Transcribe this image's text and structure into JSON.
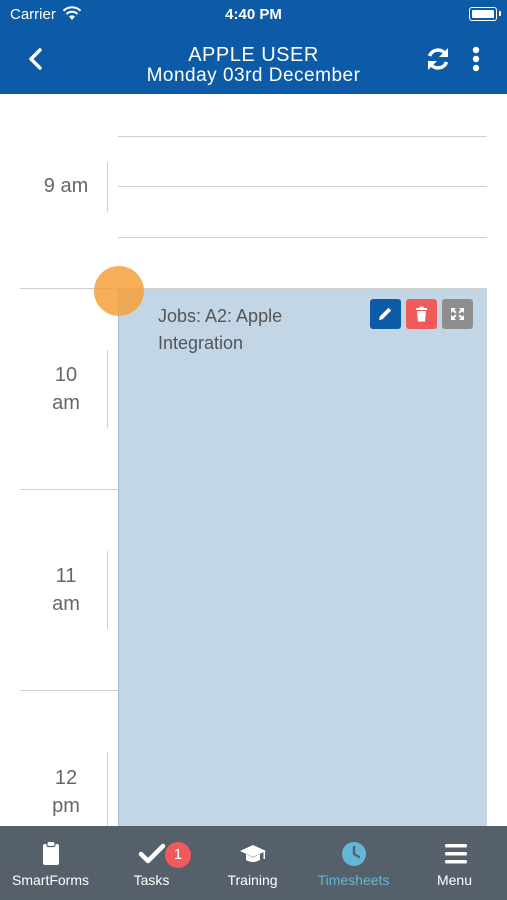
{
  "status_bar": {
    "carrier": "Carrier",
    "time": "4:40 PM"
  },
  "header": {
    "title": "APPLE USER",
    "subtitle": "Monday 03rd December"
  },
  "calendar": {
    "hours": [
      {
        "line1": "9 am",
        "line2": ""
      },
      {
        "line1": "10",
        "line2": "am"
      },
      {
        "line1": "11",
        "line2": "am"
      },
      {
        "line1": "12",
        "line2": "pm"
      }
    ],
    "event": {
      "title_line1": "Jobs: A2: Apple",
      "title_line2": "Integration"
    }
  },
  "tabs": [
    {
      "label": "SmartForms",
      "icon": "clipboard-icon"
    },
    {
      "label": "Tasks",
      "icon": "checkmark-icon",
      "badge": "1"
    },
    {
      "label": "Training",
      "icon": "graduation-cap-icon"
    },
    {
      "label": "Timesheets",
      "icon": "clock-icon",
      "active": true
    },
    {
      "label": "Menu",
      "icon": "hamburger-icon"
    }
  ],
  "colors": {
    "header": "#0d5aa7",
    "tabbar": "#56606a",
    "active_tab": "#64b6d8",
    "event": "#c3d6e5",
    "badge": "#ef5b5b"
  }
}
